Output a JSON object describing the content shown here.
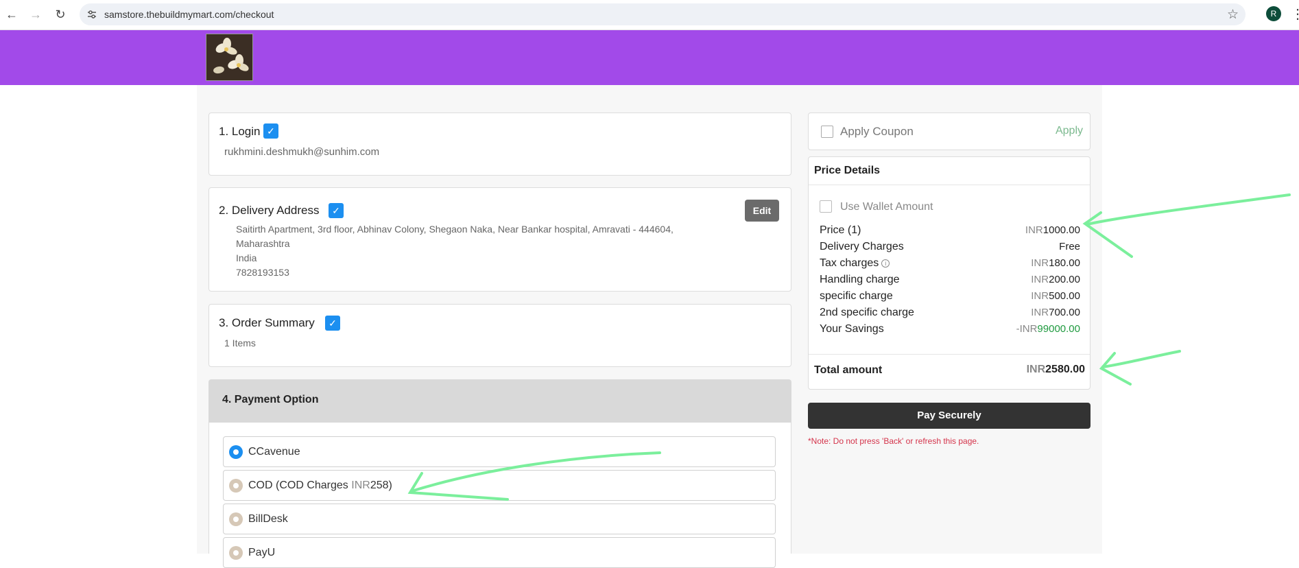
{
  "browser": {
    "url": "samstore.thebuildmymart.com/checkout",
    "profile_initial": "R"
  },
  "steps": {
    "login": {
      "title": "1. Login",
      "email": "rukhmini.deshmukh@sunhim.com"
    },
    "delivery": {
      "title": "2. Delivery Address",
      "edit_label": "Edit",
      "line1": "Saitirth Apartment, 3rd floor, Abhinav Colony, Shegaon Naka, Near Bankar hospital, Amravati - 444604,",
      "line2": "Maharashtra",
      "country": "India",
      "phone": "7828193153"
    },
    "order": {
      "title": "3. Order Summary",
      "items": "1 Items"
    },
    "payment": {
      "title": "4. Payment Option",
      "options": [
        {
          "label": "CCavenue",
          "selected": true
        },
        {
          "label_pre": "COD (COD Charges ",
          "currency": "INR",
          "amount": "258",
          "label_post": ")",
          "selected": false
        },
        {
          "label": "BillDesk",
          "selected": false
        },
        {
          "label": "PayU",
          "selected": false
        }
      ]
    }
  },
  "coupon": {
    "label": "Apply Coupon",
    "apply": "Apply"
  },
  "price_details": {
    "title": "Price Details",
    "wallet_label": "Use Wallet Amount",
    "currency": "INR",
    "rows": [
      {
        "label": "Price (1)",
        "currency": "INR",
        "value": "1000.00"
      },
      {
        "label": "Delivery Charges",
        "value": "Free"
      },
      {
        "label": "Tax charges",
        "currency": "INR",
        "value": "180.00"
      },
      {
        "label": "Handling charge",
        "currency": "INR",
        "value": "200.00"
      },
      {
        "label": "specific charge",
        "currency": "INR",
        "value": "500.00"
      },
      {
        "label": "2nd specific charge",
        "currency": "INR",
        "value": "700.00"
      },
      {
        "label": "Your Savings",
        "prefix": "-INR",
        "value": "99000.00"
      }
    ],
    "total_label": "Total amount",
    "total_currency": "INR",
    "total_value": "2580.00"
  },
  "pay_button": "Pay Securely",
  "note": "*Note: Do not press 'Back' or refresh this page.",
  "colors": {
    "header": "#a24ae9",
    "checkbox": "#1c8ff0",
    "annotation": "#7bef9c"
  }
}
